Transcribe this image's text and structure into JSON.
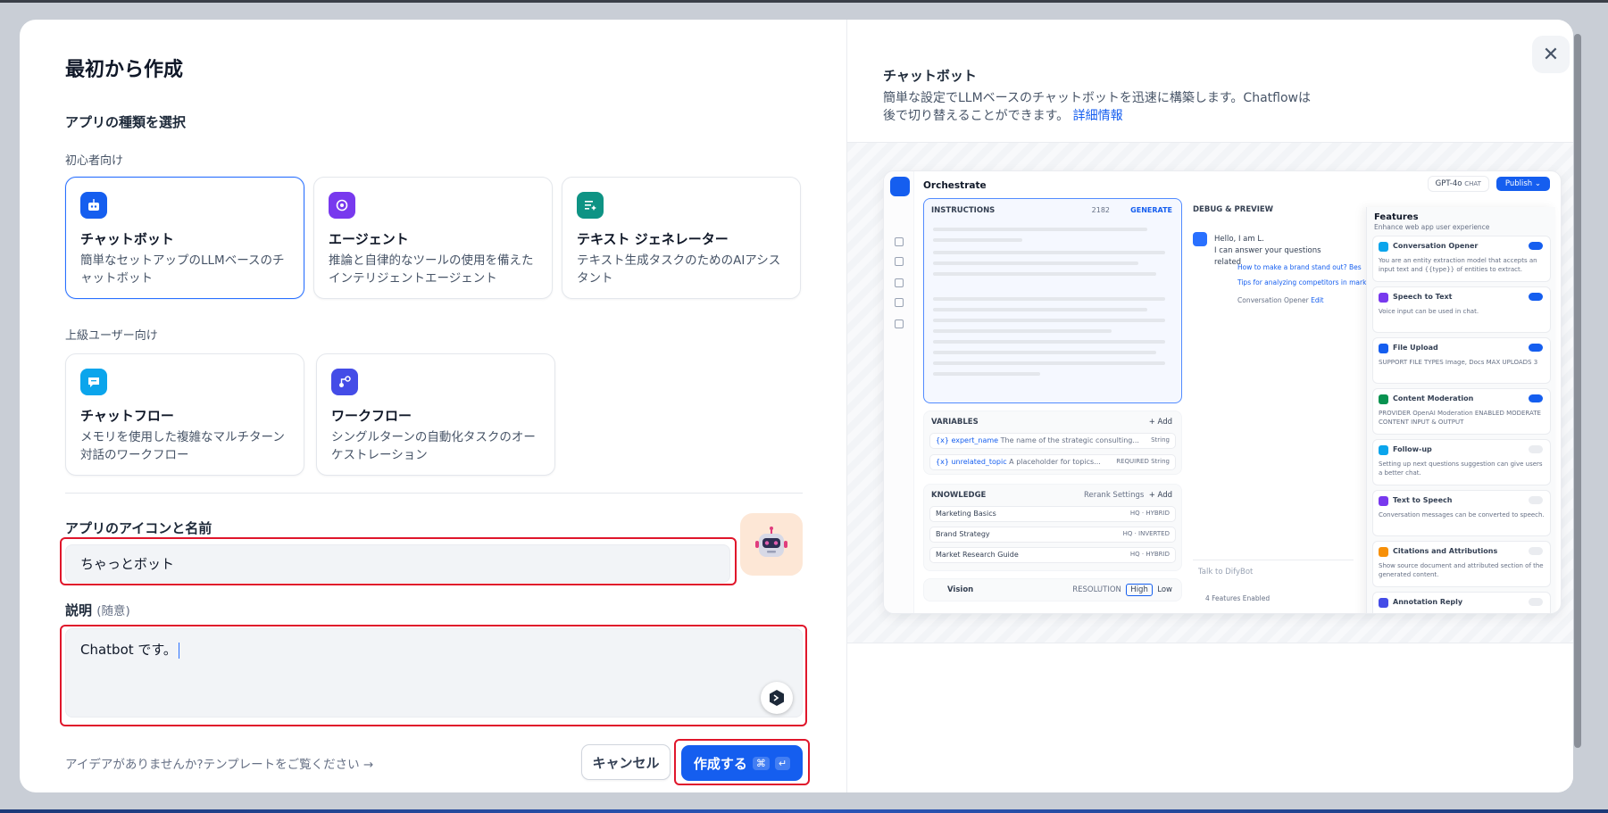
{
  "left": {
    "title": "最初から作成",
    "app_type_heading": "アプリの種類を選択",
    "beginner_label": "初心者向け",
    "advanced_label": "上級ユーザー向け",
    "beginner_cards": [
      {
        "title": "チャットボット",
        "desc": "簡単なセットアップのLLMベースのチャットボット",
        "color": "#155eef"
      },
      {
        "title": "エージェント",
        "desc": "推論と自律的なツールの使用を備えたインテリジェントエージェント",
        "color": "#7839ee"
      },
      {
        "title": "テキスト ジェネレーター",
        "desc": "テキスト生成タスクのためのAIアシスタント",
        "color": "#0e9384"
      }
    ],
    "advanced_cards": [
      {
        "title": "チャットフロー",
        "desc": "メモリを使用した複雑なマルチターン対話のワークフロー",
        "color": "#0ba5ec"
      },
      {
        "title": "ワークフロー",
        "desc": "シングルターンの自動化タスクのオーケストレーション",
        "color": "#444ce7"
      }
    ],
    "icon_name_label": "アプリのアイコンと名前",
    "name_value": "ちゃっとボット",
    "desc_label": "説明",
    "desc_optional": "(随意)",
    "desc_value": "Chatbot です。",
    "template_hint": "アイデアがありませんか?テンプレートをご覧ください →",
    "cancel_label": "キャンセル",
    "create_label": "作成する",
    "create_kbd_1": "⌘",
    "create_kbd_2": "↵"
  },
  "right": {
    "title": "チャットボット",
    "desc": "簡単な設定でLLMベースのチャットボットを迅速に構築します。Chatflowは後で切り替えることができます。",
    "link": "詳細情報",
    "close_glyph": "✕"
  },
  "mock": {
    "orchestrate": "Orchestrate",
    "model": "GPT-4o",
    "model_tag": "CHAT",
    "publish": "Publish ⌄",
    "instructions": "INSTRUCTIONS",
    "instr_count": "2182",
    "generate": "GENERATE",
    "variables": "VARIABLES",
    "add": "+ Add",
    "var1_name": "{x} expert_name",
    "var1_desc": "The name of the strategic consulting...",
    "var1_type": "String",
    "var2_name": "{x} unrelated_topic",
    "var2_desc": "A placeholder for topics...",
    "var2_req": "REQUIRED",
    "var2_type": "String",
    "knowledge": "KNOWLEDGE",
    "rerank": "Rerank Settings",
    "kb1": "Marketing Basics",
    "kb1_tag": "HQ · HYBRID",
    "kb2": "Brand Strategy",
    "kb2_tag": "HQ · INVERTED",
    "kb3": "Market Research Guide",
    "kb3_tag": "HQ · HYBRID",
    "vision": "Vision",
    "resolution": "RESOLUTION",
    "high": "High",
    "low": "Low",
    "debug": "DEBUG & PREVIEW",
    "chat_hello": "Hello, I am L.",
    "chat_line": "I can answer your questions related",
    "q1": "How to make a brand stand out?",
    "q1b": "Bes",
    "q2": "Tips for analyzing competitors in market",
    "opener": "Conversation Opener",
    "edit": "Edit",
    "talk": "Talk to DifyBot",
    "features_enabled": "4 Features Enabled",
    "features_title": "Features",
    "features_sub": "Enhance web app user experience",
    "features": [
      {
        "name": "Conversation Opener",
        "desc": "You are an entity extraction model that accepts an input text and {{type}} of entities to extract.",
        "on": true,
        "color": "#0ba5ec"
      },
      {
        "name": "Speech to Text",
        "desc": "Voice input can be used in chat.",
        "on": true,
        "color": "#7839ee"
      },
      {
        "name": "File Upload",
        "desc": "SUPPORT FILE TYPES  Image, Docs     MAX UPLOADS  3",
        "on": true,
        "color": "#155eef"
      },
      {
        "name": "Content Moderation",
        "desc": "PROVIDER OpenAI Moderation   ENABLED MODERATE CONTENT INPUT & OUTPUT",
        "on": true,
        "color": "#099250"
      },
      {
        "name": "Follow-up",
        "desc": "Setting up next questions suggestion can give users a better chat.",
        "on": false,
        "color": "#0ba5ec"
      },
      {
        "name": "Text to Speech",
        "desc": "Conversation messages can be converted to speech.",
        "on": false,
        "color": "#7839ee"
      },
      {
        "name": "Citations and Attributions",
        "desc": "Show source document and attributed section of the generated content.",
        "on": false,
        "color": "#f79009"
      },
      {
        "name": "Annotation Reply",
        "desc": "",
        "on": false,
        "color": "#444ce7"
      }
    ]
  }
}
